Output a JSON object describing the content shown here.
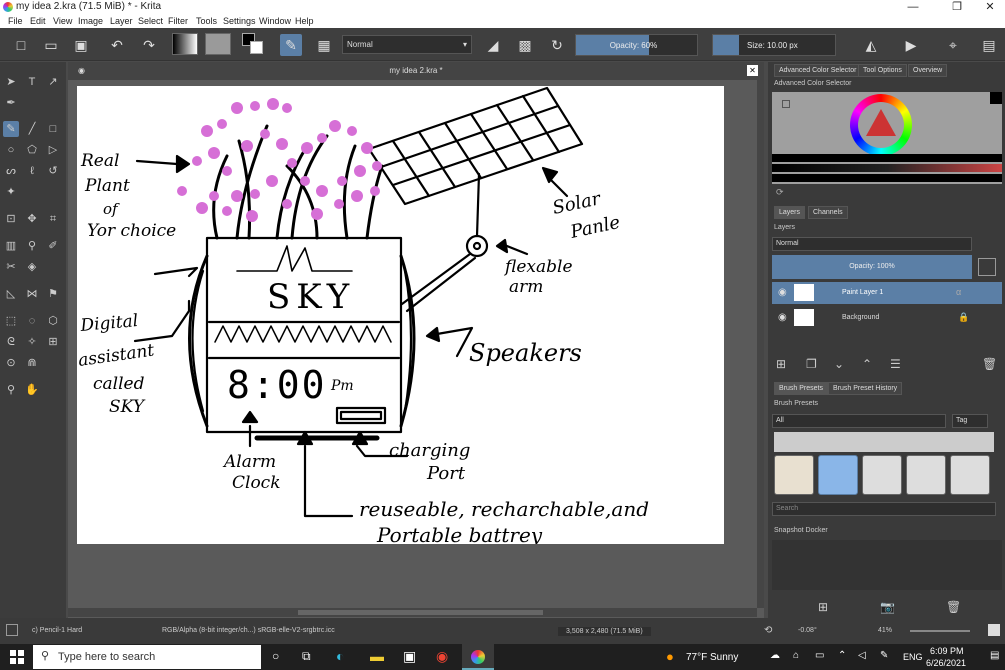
{
  "window": {
    "title": "my idea 2.kra (71.5 MiB)  * - Krita",
    "minimize": "—",
    "maximize": "❐",
    "close": "✕"
  },
  "menu": [
    "File",
    "Edit",
    "View",
    "Image",
    "Layer",
    "Select",
    "Filter",
    "Tools",
    "Settings",
    "Window",
    "Help"
  ],
  "toolbar": {
    "blend_mode": "Normal",
    "opacity": "Opacity: 60%",
    "opacity_value": 0.6,
    "size": "Size: 10.00 px"
  },
  "document": {
    "tab_title": "my idea 2.kra *"
  },
  "drawing": {
    "labels": {
      "real_plant": [
        "Real",
        "Plant",
        "of",
        "Yor choice"
      ],
      "solar": [
        "Solar",
        "Panle"
      ],
      "arm": [
        "flexable",
        "arm"
      ],
      "sky": "SKY",
      "assistant": [
        "Digital",
        "assistant",
        "called",
        "SKY"
      ],
      "speakers": "Speakers",
      "time": "8:00",
      "pm": "Pm",
      "alarm": [
        "Alarm",
        "Clock"
      ],
      "charging": [
        "charging",
        "Port"
      ],
      "battery": [
        "reuseable, recharchable,and",
        "Portable battrey"
      ]
    }
  },
  "dock": {
    "color_tabs": [
      "Advanced Color Selector",
      "Tool Options",
      "Overview"
    ],
    "color_title": "Advanced Color Selector",
    "layer_tabs": [
      "Layers",
      "Channels"
    ],
    "layers_title": "Layers",
    "layer_mode": "Normal",
    "layer_opacity": "Opacity:  100%",
    "layers": [
      {
        "name": "Paint Layer 1"
      },
      {
        "name": "Background"
      }
    ],
    "brush_tabs": [
      "Brush Presets",
      "Brush Preset History"
    ],
    "brush_title": "Brush Presets",
    "brush_filter": "All",
    "tag": "Tag",
    "search_placeholder": "Search",
    "snapshot_title": "Snapshot Docker"
  },
  "status": {
    "brush": "c) Pencil-1 Hard",
    "color_space": "RGB/Alpha (8-bit integer/ch...)  sRGB-elle-V2-srgbtrc.icc",
    "dimensions": "3,508 x 2,480 (71.5 MiB)",
    "rotation": "-0.08°",
    "zoom": "41%"
  },
  "taskbar": {
    "search_placeholder": "Type here to search",
    "weather": "77°F  Sunny",
    "lang": "ENG",
    "time": "6:09 PM",
    "date": "6/26/2021"
  },
  "colors": {
    "accent": "#5b7fa6",
    "blossom": "#d66fd6"
  }
}
